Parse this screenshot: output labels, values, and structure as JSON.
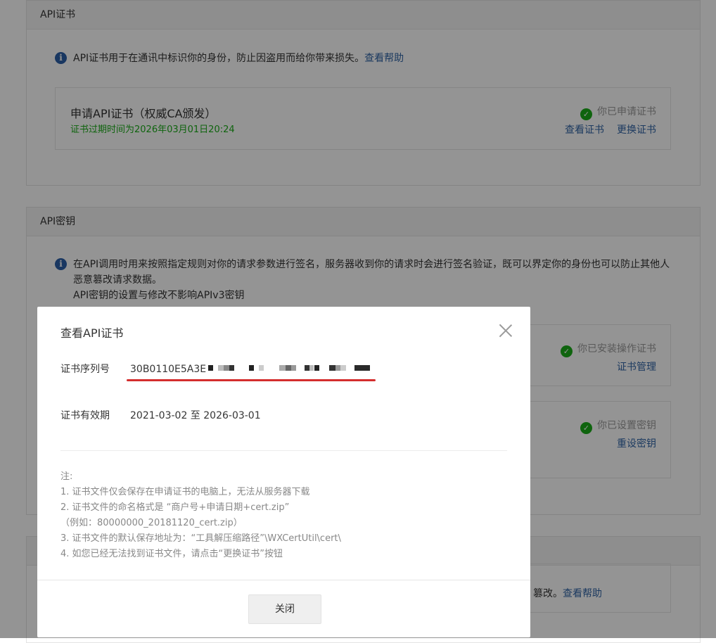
{
  "cert_section": {
    "title": "API证书",
    "info_text": "API证书用于在通讯中标识你的身份，防止因盗用而给你带来损失。",
    "help_link": "查看帮助",
    "card": {
      "title": "申请API证书（权威CA颁发）",
      "expiry": "证书过期时间为2026年03月01日20:24",
      "status": "你已申请证书",
      "view_link": "查看证书",
      "replace_link": "更换证书"
    }
  },
  "key_section": {
    "title": "API密钥",
    "info_line1": "在API调用时用来按照指定规则对你的请求参数进行签名，服务器收到你的请求时会进行签名验证，既可以界定你的身份也可以防止其他人",
    "info_line2": "恶意篡改请求数据。",
    "info_line3": "API密钥的设置与修改不影响APIv3密钥",
    "card1": {
      "status": "你已安装操作证书",
      "link": "证书管理"
    },
    "card2": {
      "status": "你已设置密钥",
      "link": "重设密钥"
    }
  },
  "bottom_section": {
    "tail_text": "篡改。",
    "help_link": "查看帮助"
  },
  "dialog": {
    "title": "查看API证书",
    "serial_label": "证书序列号",
    "serial_prefix": "30B0110E5A3E",
    "validity_label": "证书有效期",
    "validity_value": "2021-03-02 至 2026-03-01",
    "notes": [
      "注:",
      "1. 证书文件仅会保存在申请证书的电脑上，无法从服务器下载",
      "2. 证书文件的命名格式是 “商户号+申请日期+cert.zip”",
      "（例如：80000000_20181120_cert.zip）",
      "3. 证书文件的默认保存地址为：“工具解压缩路径”\\WXCertUtil\\cert\\",
      "4. 如您已经无法找到证书文件，请点击“更换证书”按钮"
    ],
    "close_button": "关闭"
  },
  "colors": {
    "link": "#3164a6",
    "success": "#1aad19",
    "annotation": "#d42e2e"
  },
  "icons": [
    "info-icon",
    "check-circle-icon",
    "close-icon"
  ]
}
